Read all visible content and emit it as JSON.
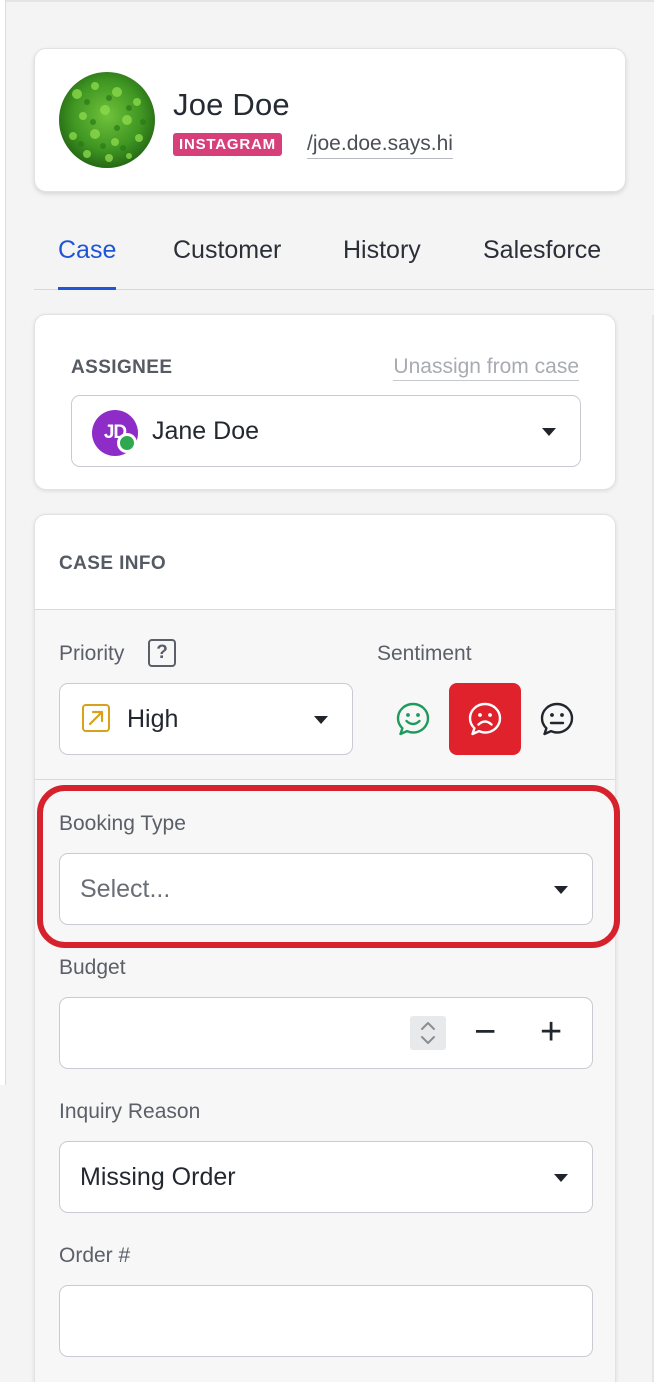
{
  "profile": {
    "name": "Joe Doe",
    "channel_badge": "INSTAGRAM",
    "handle": "/joe.doe.says.hi",
    "avatar_icon": "leaf-photo-icon"
  },
  "tabs": [
    {
      "label": "Case",
      "active": true
    },
    {
      "label": "Customer",
      "active": false
    },
    {
      "label": "History",
      "active": false
    },
    {
      "label": "Salesforce",
      "active": false
    }
  ],
  "assignee": {
    "section_title": "ASSIGNEE",
    "unassign_label": "Unassign from case",
    "user_initials": "JD",
    "user_name": "Jane Doe",
    "status": "online"
  },
  "case_info": {
    "section_title": "CASE INFO",
    "priority": {
      "label": "Priority",
      "help_glyph": "?",
      "value": "High",
      "icon": "arrow-up-right-icon"
    },
    "sentiment": {
      "label": "Sentiment",
      "options": [
        {
          "name": "positive",
          "icon": "smile-chat-icon",
          "selected": false
        },
        {
          "name": "negative",
          "icon": "frown-chat-icon",
          "selected": true
        },
        {
          "name": "neutral",
          "icon": "neutral-chat-icon",
          "selected": false
        }
      ]
    },
    "booking_type": {
      "label": "Booking Type",
      "placeholder": "Select..."
    },
    "budget": {
      "label": "Budget",
      "value": "",
      "minus": "−",
      "plus": "+"
    },
    "inquiry_reason": {
      "label": "Inquiry Reason",
      "value": "Missing Order"
    },
    "order_number": {
      "label": "Order #",
      "value": ""
    }
  },
  "colors": {
    "accent": "#1f56d8",
    "badge": "#d63f7a",
    "negative": "#e0222c",
    "positive": "#1f9a5e",
    "highlight": "#d6222d"
  }
}
